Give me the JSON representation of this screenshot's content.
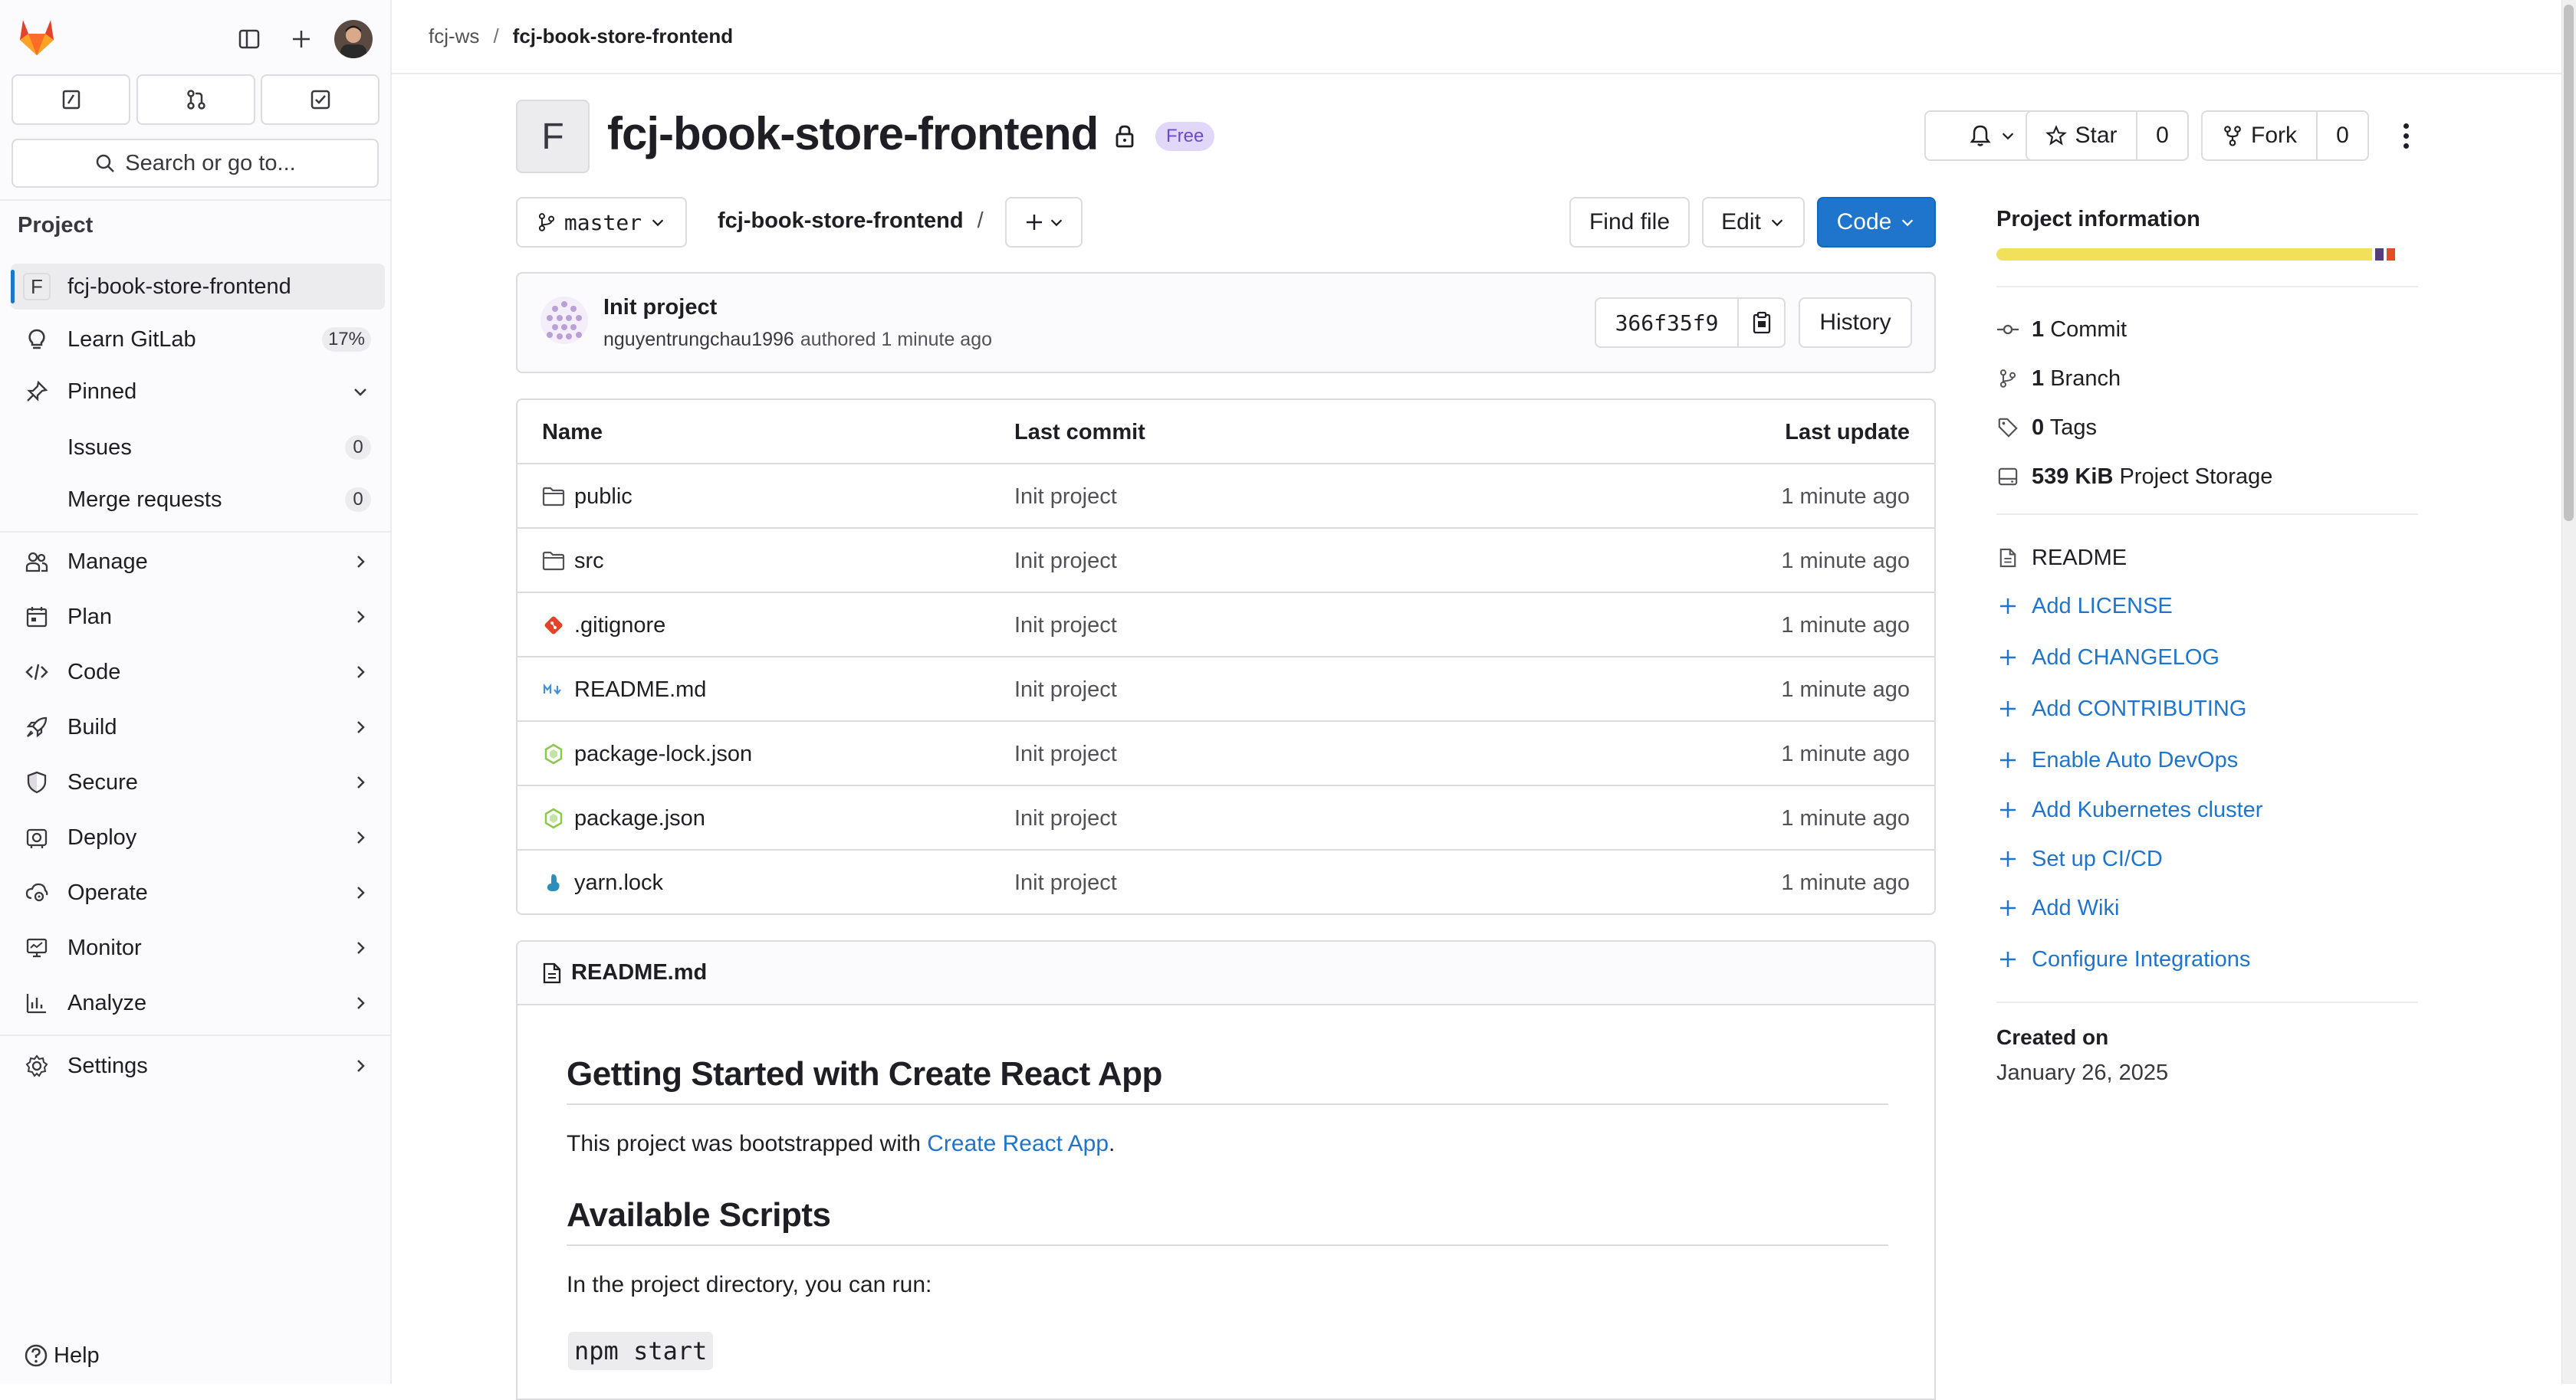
{
  "sidebar": {
    "search_label": "Search or go to...",
    "section_heading": "Project",
    "project_item": {
      "avatar": "F",
      "label": "fcj-book-store-frontend"
    },
    "learn": {
      "label": "Learn GitLab",
      "badge": "17%"
    },
    "pinned": {
      "label": "Pinned"
    },
    "issues": {
      "label": "Issues",
      "count": "0"
    },
    "merge_requests": {
      "label": "Merge requests",
      "count": "0"
    },
    "items": [
      {
        "label": "Manage",
        "icon": "users-icon"
      },
      {
        "label": "Plan",
        "icon": "calendar-icon"
      },
      {
        "label": "Code",
        "icon": "code-icon"
      },
      {
        "label": "Build",
        "icon": "rocket-icon"
      },
      {
        "label": "Secure",
        "icon": "shield-icon"
      },
      {
        "label": "Deploy",
        "icon": "deploy-icon"
      },
      {
        "label": "Operate",
        "icon": "cloud-gear-icon"
      },
      {
        "label": "Monitor",
        "icon": "monitor-icon"
      },
      {
        "label": "Analyze",
        "icon": "chart-icon"
      },
      {
        "label": "Settings",
        "icon": "gear-icon"
      }
    ],
    "help_label": "Help"
  },
  "breadcrumb": {
    "group": "fcj-ws",
    "separator": "/",
    "project": "fcj-book-store-frontend"
  },
  "project": {
    "avatar": "F",
    "title": "fcj-book-store-frontend",
    "tier_badge": "Free",
    "star_label": "Star",
    "star_count": "0",
    "fork_label": "Fork",
    "fork_count": "0"
  },
  "repo_toolbar": {
    "branch": "master",
    "path": "fcj-book-store-frontend",
    "path_separator": "/",
    "find_file": "Find file",
    "edit": "Edit",
    "code": "Code"
  },
  "last_commit": {
    "title": "Init project",
    "author": "nguyentrungchau1996",
    "authored_text": "authored 1 minute ago",
    "sha": "366f35f9",
    "history": "History"
  },
  "file_table": {
    "headers": {
      "name": "Name",
      "last_commit": "Last commit",
      "last_update": "Last update"
    },
    "rows": [
      {
        "name": "public",
        "icon": "folder-icon",
        "commit": "Init project",
        "updated": "1 minute ago"
      },
      {
        "name": "src",
        "icon": "folder-icon",
        "commit": "Init project",
        "updated": "1 minute ago"
      },
      {
        "name": ".gitignore",
        "icon": "git-icon",
        "commit": "Init project",
        "updated": "1 minute ago"
      },
      {
        "name": "README.md",
        "icon": "markdown-icon",
        "commit": "Init project",
        "updated": "1 minute ago"
      },
      {
        "name": "package-lock.json",
        "icon": "nodejs-icon",
        "commit": "Init project",
        "updated": "1 minute ago"
      },
      {
        "name": "package.json",
        "icon": "nodejs-icon",
        "commit": "Init project",
        "updated": "1 minute ago"
      },
      {
        "name": "yarn.lock",
        "icon": "yarn-icon",
        "commit": "Init project",
        "updated": "1 minute ago"
      }
    ]
  },
  "readme": {
    "filename": "README.md",
    "h1": "Getting Started with Create React App",
    "p1_before": "This project was bootstrapped with ",
    "p1_link": "Create React App",
    "p1_after": ".",
    "h2": "Available Scripts",
    "p2": "In the project directory, you can run:",
    "code1": "npm start"
  },
  "project_info": {
    "title": "Project information",
    "language_colors": [
      "#f1e05a",
      "#563d7c",
      "#e34c26"
    ],
    "language_shares": [
      0.89,
      0.02,
      0.02
    ],
    "stats": {
      "commits_count": "1",
      "commits_label": "Commit",
      "branches_count": "1",
      "branches_label": "Branch",
      "tags_count": "0",
      "tags_label": "Tags",
      "storage_value": "539 KiB",
      "storage_label": "Project Storage"
    },
    "readme_label": "README",
    "actions": [
      "Add LICENSE",
      "Add CHANGELOG",
      "Add CONTRIBUTING",
      "Enable Auto DevOps",
      "Add Kubernetes cluster",
      "Set up CI/CD",
      "Add Wiki",
      "Configure Integrations"
    ],
    "created_label": "Created on",
    "created_date": "January 26, 2025"
  },
  "colors": {
    "link": "#1f75cb",
    "code_button": "#1f75cb",
    "badge_bg": "#e1d8f9",
    "badge_text": "#6e49cb"
  }
}
